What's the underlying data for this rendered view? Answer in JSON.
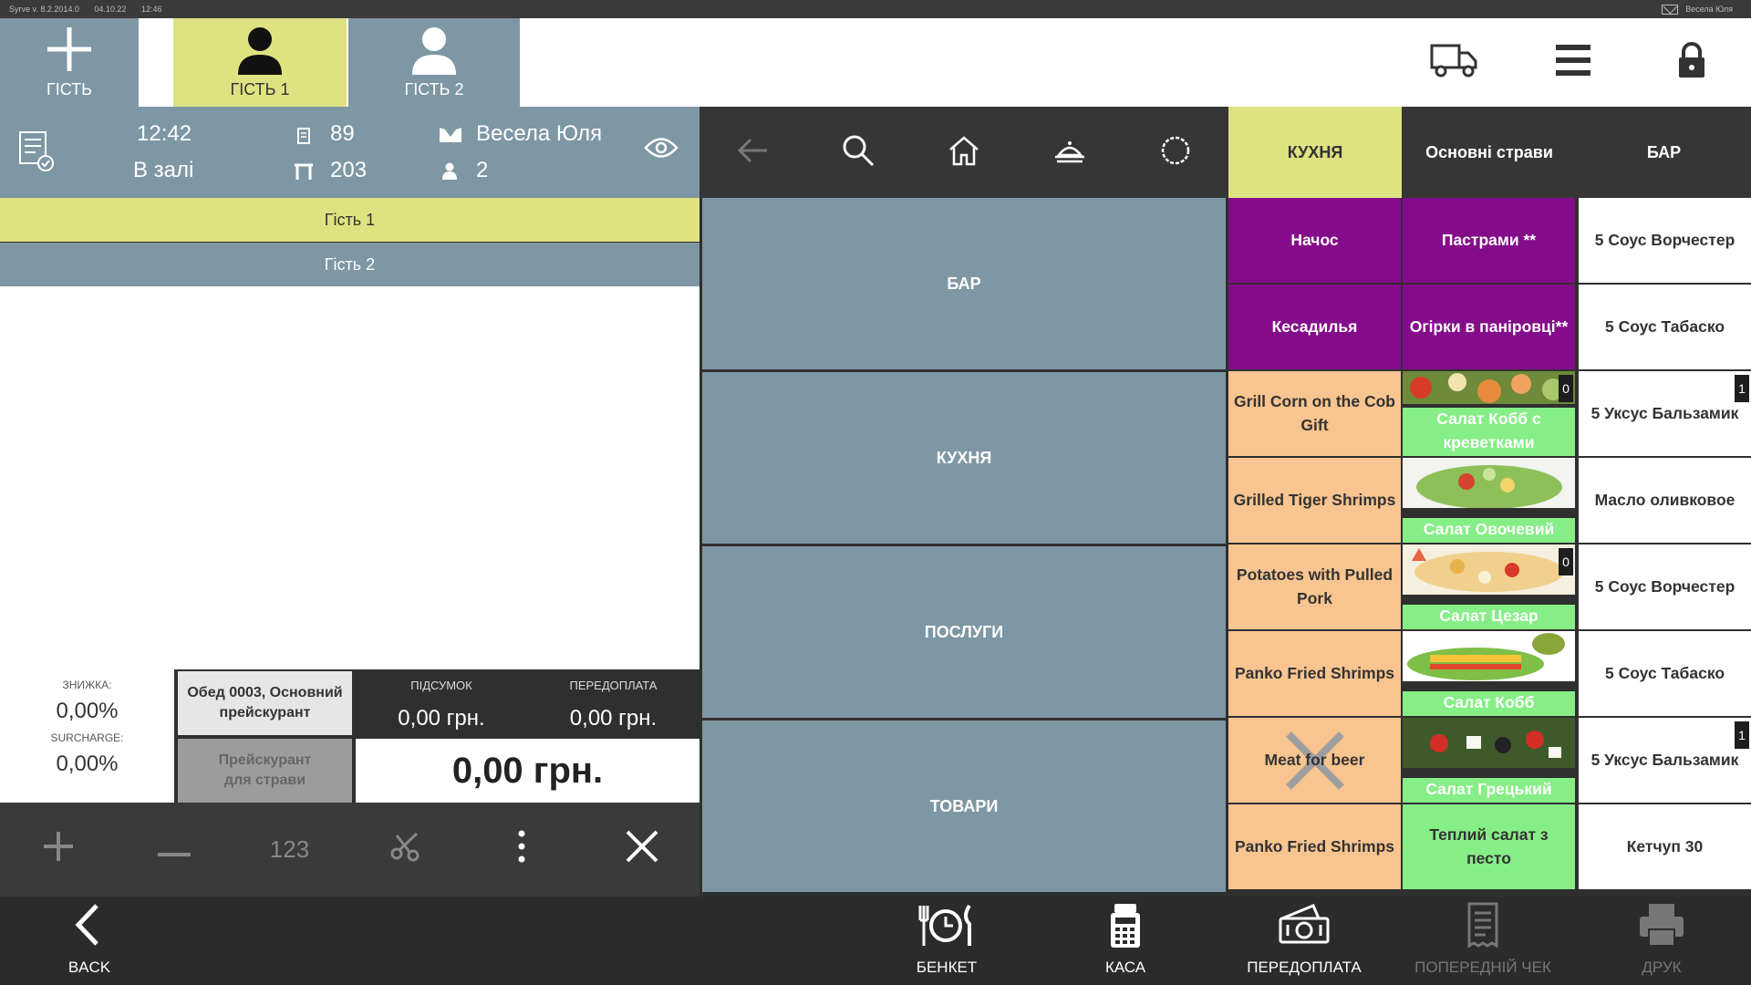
{
  "titlebar": {
    "version": "Syrve v. 8.2.2014.0",
    "date": "04.10.22",
    "time": "12:46",
    "user": "Весела Юля"
  },
  "guest_tabs": [
    {
      "label": "ГІСТЬ",
      "icon": "plus-icon"
    },
    {
      "label": "ГІСТЬ 1",
      "icon": "person-icon"
    },
    {
      "label": "ГІСТЬ 2",
      "icon": "person-outline-icon"
    }
  ],
  "order": {
    "time": "12:42",
    "location": "В залі",
    "order_number": "89",
    "table_number": "203",
    "waiter": "Весела Юля",
    "guests_count": "2"
  },
  "guest_rows": [
    "Гість 1",
    "Гість 2"
  ],
  "totals": {
    "discount_label": "ЗНИЖКА:",
    "discount_value": "0,00%",
    "surcharge_label": "SURCHARGE:",
    "surcharge_value": "0,00%",
    "price_list": "Обед 0003, Основний прейскурант",
    "dish_price_list": "Прейскурант для страви",
    "subtotal_label": "ПІДСУМОК",
    "subtotal_value": "0,00 грн.",
    "prepayment_label": "ПЕРЕДОПЛАТА",
    "prepayment_value": "0,00 грн.",
    "total_value": "0,00 грн."
  },
  "controls": {
    "qty_label": "123"
  },
  "menu_tabs": [
    "КУХНЯ",
    "Основні страви",
    "БАР"
  ],
  "categories": [
    "БАР",
    "КУХНЯ",
    "ПОСЛУГИ",
    "ТОВАРИ"
  ],
  "products": {
    "col1": [
      "Начос",
      "Кесадилья",
      "Grill Corn on the Cob Gift",
      "Grilled Tiger Shrimps",
      "Potatoes with Pulled Pork",
      "Panko Fried Shrimps",
      "Meat for beer",
      "Panko Fried Shrimps"
    ],
    "col2": [
      "Пастрами **",
      "Огірки в паніровці**",
      "Салат Кобб с креветками",
      "Салат Овочевий",
      "Салат Цезар",
      "Салат Кобб",
      "Салат Грецький",
      "Теплий салат з песто"
    ],
    "col3": [
      "5 Соус Ворчестер",
      "5 Соус Табаско",
      "5 Уксус Бальзамик",
      "Масло оливковое",
      "5 Соус Ворчестер",
      "5 Соус Табаско",
      "5 Уксус Бальзамик",
      "Кетчуп 30"
    ]
  },
  "badges": {
    "cobb_shrimp": "0",
    "caesar": "0",
    "balsamic_1": "1",
    "balsamic_2": "1"
  },
  "bottom": {
    "back": "BACK",
    "banquet": "БЕНКЕТ",
    "cash": "КАСА",
    "prepayment": "ПЕРЕДОПЛАТА",
    "pre_check": "ПОПЕРЕДНІЙ ЧЕК",
    "print": "ДРУК"
  },
  "colors": {
    "accent": "#dfe280",
    "panel": "#7e97a4",
    "purple": "#840c8a",
    "peach": "#f8c48f",
    "green": "#86ee86"
  }
}
